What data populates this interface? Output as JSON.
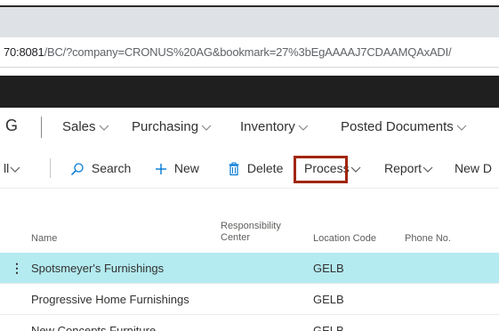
{
  "browser": {
    "url_host": "70:8081",
    "url_rest": "/BC/?company=CRONUS%20AG&bookmark=27%3bEgAAAAJ7CDAAMQAxADI/"
  },
  "nav": {
    "company_fragment": "G",
    "items": [
      {
        "label": "Sales"
      },
      {
        "label": "Purchasing"
      },
      {
        "label": "Inventory"
      },
      {
        "label": "Posted Documents"
      }
    ]
  },
  "actions": {
    "partial_label": "ll",
    "search": "Search",
    "new": "New",
    "delete": "Delete",
    "process": "Process",
    "report": "Report",
    "new_document_partial": "New D"
  },
  "table": {
    "columns": {
      "name": "Name",
      "responsibility_center": "Responsibility Center",
      "location_code": "Location Code",
      "phone": "Phone No."
    },
    "rows": [
      {
        "name": "Spotsmeyer's Furnishings",
        "location": "GELB"
      },
      {
        "name": "Progressive Home Furnishings",
        "location": "GELB"
      },
      {
        "name": "New Concepts Furniture",
        "location": "GELB"
      }
    ]
  },
  "colors": {
    "highlight_border": "#a1260d",
    "selected_row": "#b4ebf0",
    "app_bar": "#1f1f1f"
  }
}
